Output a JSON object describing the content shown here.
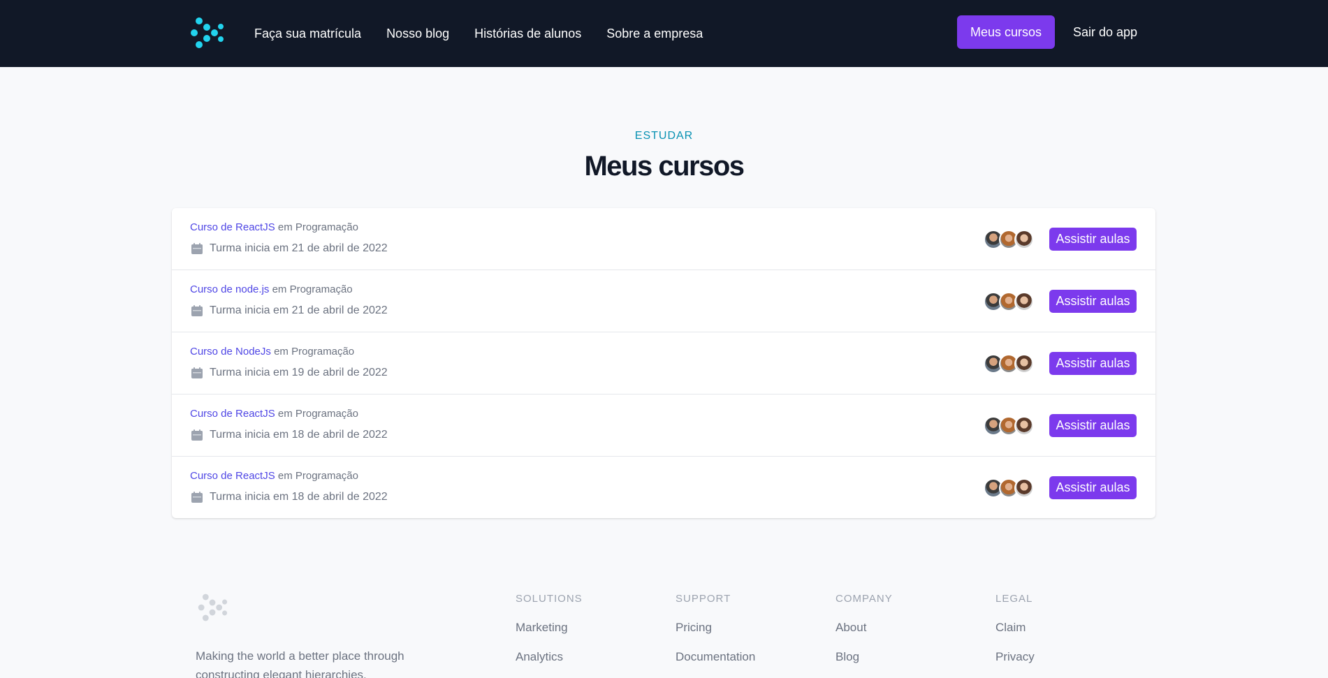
{
  "nav": {
    "logo": "brand-logo",
    "links": [
      "Faça sua matrícula",
      "Nosso blog",
      "Histórias de alunos",
      "Sobre a empresa"
    ],
    "primary_button": "Meus cursos",
    "logout": "Sair do app",
    "accent_color": "#7c3aed",
    "background": "#111827"
  },
  "header": {
    "eyebrow": "ESTUDAR",
    "title": "Meus cursos"
  },
  "courses": [
    {
      "name": "Curso de ReactJS",
      "category_prefix": " em ",
      "category": "Programação",
      "start": "Turma inicia em 21 de abril de 2022",
      "button": "Assistir aulas"
    },
    {
      "name": "Curso de node.js",
      "category_prefix": " em ",
      "category": "Programação",
      "start": "Turma inicia em 21 de abril de 2022",
      "button": "Assistir aulas"
    },
    {
      "name": "Curso de NodeJs",
      "category_prefix": " em ",
      "category": "Programação",
      "start": "Turma inicia em 19 de abril de 2022",
      "button": "Assistir aulas"
    },
    {
      "name": "Curso de ReactJS",
      "category_prefix": " em ",
      "category": "Programação",
      "start": "Turma inicia em 18 de abril de 2022",
      "button": "Assistir aulas"
    },
    {
      "name": "Curso de ReactJS",
      "category_prefix": " em ",
      "category": "Programação",
      "start": "Turma inicia em 18 de abril de 2022",
      "button": "Assistir aulas"
    }
  ],
  "footer": {
    "tagline": "Making the world a better place through constructing elegant hierarchies.",
    "columns": [
      {
        "heading": "SOLUTIONS",
        "items": [
          "Marketing",
          "Analytics"
        ]
      },
      {
        "heading": "SUPPORT",
        "items": [
          "Pricing",
          "Documentation"
        ]
      },
      {
        "heading": "COMPANY",
        "items": [
          "About",
          "Blog"
        ]
      },
      {
        "heading": "LEGAL",
        "items": [
          "Claim",
          "Privacy"
        ]
      }
    ]
  }
}
